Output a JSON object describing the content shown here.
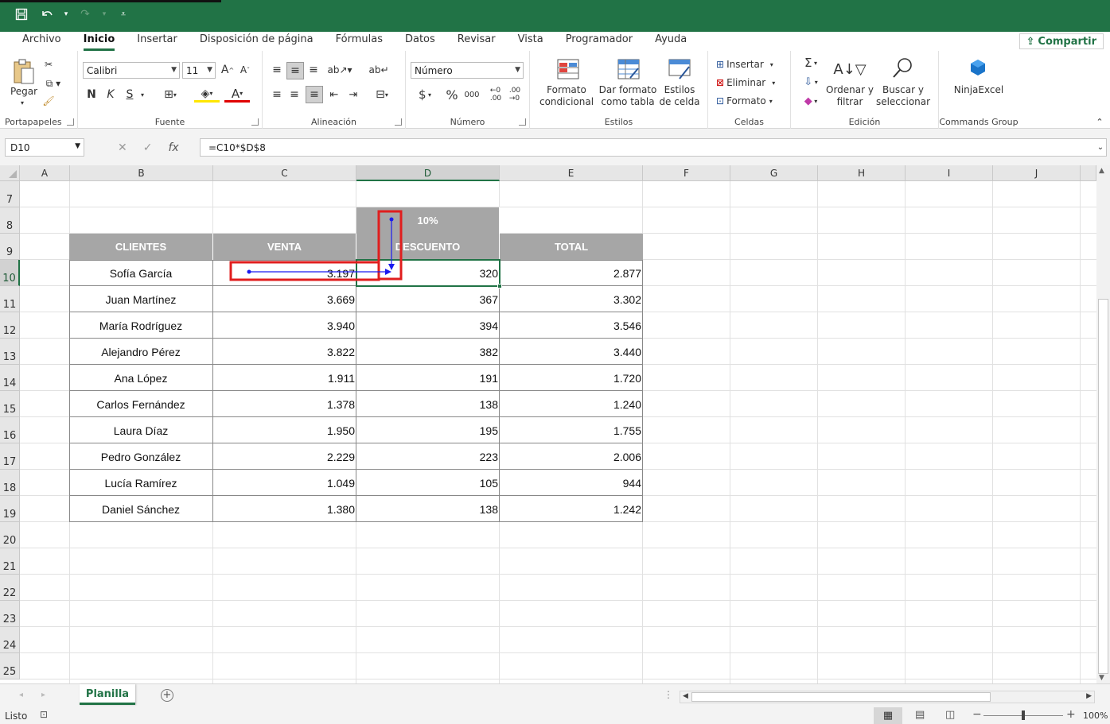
{
  "qat": {
    "save_icon": "save-icon",
    "undo_icon": "undo-icon",
    "redo_icon": "redo-icon"
  },
  "menu": [
    "Archivo",
    "Inicio",
    "Insertar",
    "Disposición de página",
    "Fórmulas",
    "Datos",
    "Revisar",
    "Vista",
    "Programador",
    "Ayuda"
  ],
  "share_label": "Compartir",
  "ribbon": {
    "paste_label": "Pegar",
    "clipboard_label": "Portapapeles",
    "font_name": "Calibri",
    "font_size": "11",
    "bold": "N",
    "italic": "K",
    "underline": "S",
    "font_label": "Fuente",
    "align_label": "Alineación",
    "number_format": "Número",
    "number_label": "Número",
    "cond_format": "Formato condicional",
    "table_format": "Dar formato como tabla",
    "cell_styles": "Estilos de celda",
    "styles_label": "Estilos",
    "insert": "Insertar",
    "delete": "Eliminar",
    "format": "Formato",
    "cells_label": "Celdas",
    "sort_filter": "Ordenar y filtrar",
    "find_select": "Buscar y seleccionar",
    "edit_label": "Edición",
    "ninja": "NinjaExcel",
    "commands_label": "Commands Group"
  },
  "formula_bar": {
    "name_box": "D10",
    "formula": "=C10*$D$8",
    "fx": "fx"
  },
  "columns": [
    "A",
    "B",
    "C",
    "D",
    "E",
    "F",
    "G",
    "H",
    "I",
    "J"
  ],
  "rows": [
    "7",
    "8",
    "9",
    "10",
    "11",
    "12",
    "13",
    "14",
    "15",
    "16",
    "17",
    "18",
    "19",
    "20",
    "21",
    "22",
    "23",
    "24",
    "25"
  ],
  "discount_pct": "10%",
  "table_headers": {
    "clientes": "CLIENTES",
    "venta": "VENTA",
    "descuento": "DESCUENTO",
    "total": "TOTAL"
  },
  "table_rows": [
    {
      "cliente": "Sofía García",
      "venta": "3.197",
      "descuento": "320",
      "total": "2.877"
    },
    {
      "cliente": "Juan Martínez",
      "venta": "3.669",
      "descuento": "367",
      "total": "3.302"
    },
    {
      "cliente": "María Rodríguez",
      "venta": "3.940",
      "descuento": "394",
      "total": "3.546"
    },
    {
      "cliente": "Alejandro Pérez",
      "venta": "3.822",
      "descuento": "382",
      "total": "3.440"
    },
    {
      "cliente": "Ana López",
      "venta": "1.911",
      "descuento": "191",
      "total": "1.720"
    },
    {
      "cliente": "Carlos Fernández",
      "venta": "1.378",
      "descuento": "138",
      "total": "1.240"
    },
    {
      "cliente": "Laura Díaz",
      "venta": "1.950",
      "descuento": "195",
      "total": "1.755"
    },
    {
      "cliente": "Pedro González",
      "venta": "2.229",
      "descuento": "223",
      "total": "2.006"
    },
    {
      "cliente": "Lucía Ramírez",
      "venta": "1.049",
      "descuento": "105",
      "total": "944"
    },
    {
      "cliente": "Daniel Sánchez",
      "venta": "1.380",
      "descuento": "138",
      "total": "1.242"
    }
  ],
  "sheet_tab": "Planilla",
  "status": {
    "ready": "Listo",
    "zoom": "100%"
  },
  "colors": {
    "accent": "#217346",
    "header_fill": "#a6a6a6",
    "trace_arrow": "#0000ff",
    "highlight_box": "#e01e1e"
  }
}
